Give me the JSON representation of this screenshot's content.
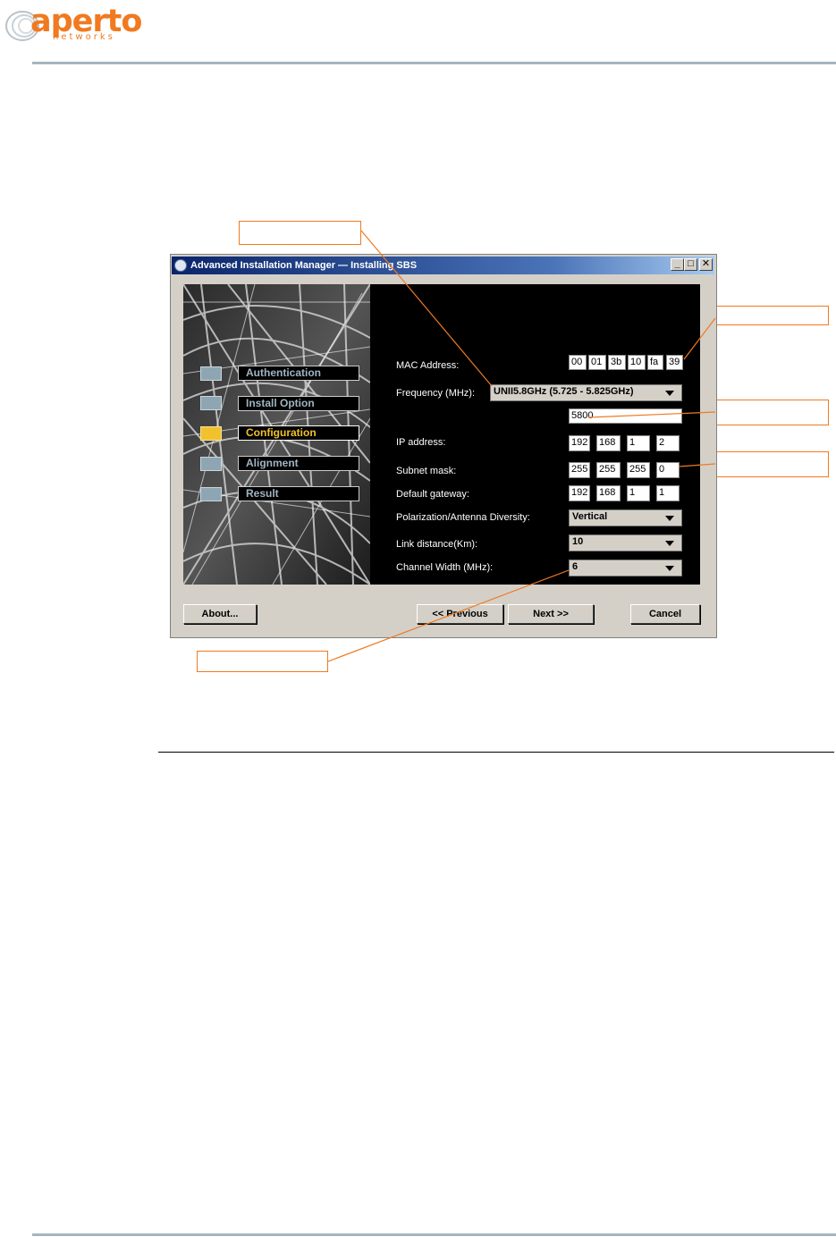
{
  "header": {
    "brand": "aperto",
    "brand_sub": "networks"
  },
  "window": {
    "title": "Advanced Installation Manager — Installing SBS",
    "controls": {
      "minimize": "_",
      "maximize": "□",
      "close": "✕"
    }
  },
  "steps": [
    {
      "label": "Authentication",
      "active": false
    },
    {
      "label": "Install Option",
      "active": false
    },
    {
      "label": "Configuration",
      "active": true
    },
    {
      "label": "Alignment",
      "active": false
    },
    {
      "label": "Result",
      "active": false
    }
  ],
  "form": {
    "mac_label": "MAC Address:",
    "mac": [
      "00",
      "01",
      "3b",
      "10",
      "fa",
      "39"
    ],
    "frequency_label": "Frequency (MHz):",
    "frequency_band": "UNII5.8GHz (5.725 - 5.825GHz)",
    "frequency_value": "5800",
    "ip_label": "IP address:",
    "ip": [
      "192",
      "168",
      "1",
      "2"
    ],
    "subnet_label": "Subnet mask:",
    "subnet": [
      "255",
      "255",
      "255",
      "0"
    ],
    "gateway_label": "Default gateway:",
    "gateway": [
      "192",
      "168",
      "1",
      "1"
    ],
    "polarization_label": "Polarization/Antenna Diversity:",
    "polarization_value": "Vertical",
    "link_label": "Link distance(Km):",
    "link_value": "10",
    "channel_label": "Channel Width (MHz):",
    "channel_value": "6"
  },
  "buttons": {
    "about": "About...",
    "previous": "<< Previous",
    "next": "Next >>",
    "cancel": "Cancel"
  },
  "colors": {
    "accent_orange": "#f07a20",
    "active_step": "#f2c12e",
    "title_bar": "#0a246a"
  }
}
